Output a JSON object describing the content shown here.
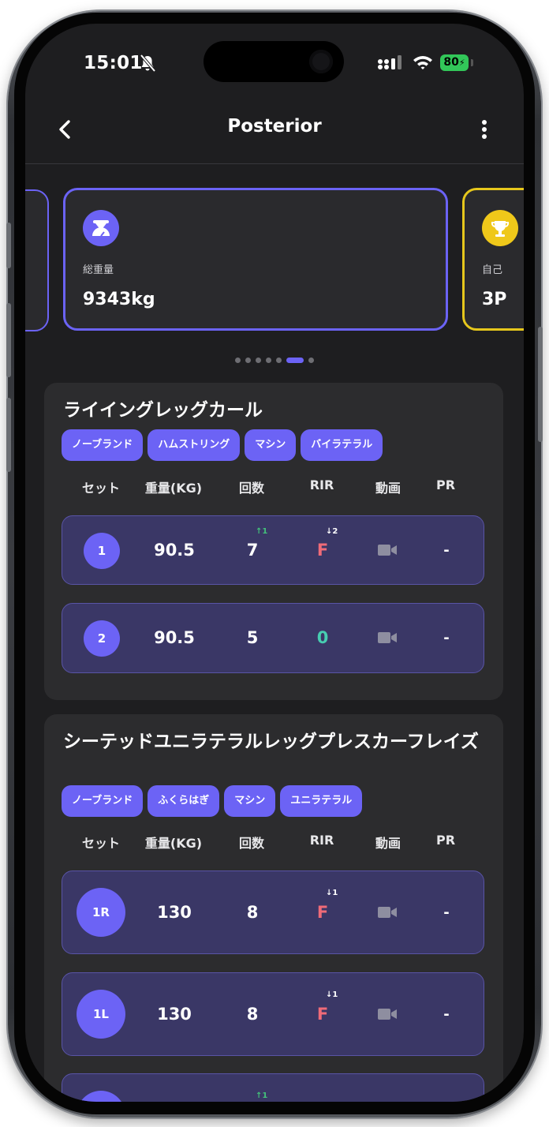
{
  "status_bar": {
    "time": "15:01",
    "battery": "80"
  },
  "header": {
    "title": "Posterior"
  },
  "summary_cards": [
    {
      "label": "総重量",
      "value": "9343kg",
      "icon": "weight-scale-icon",
      "accent": "#6c63f5"
    },
    {
      "label": "自己",
      "value": "3P",
      "icon": "trophy-icon",
      "accent": "#efc81a"
    }
  ],
  "carousel": {
    "dot_count": 7,
    "active_index": 5
  },
  "column_headers": [
    "セット",
    "重量(KG)",
    "回数",
    "RIR",
    "動画",
    "PR"
  ],
  "exercises": [
    {
      "name": "ライイングレッグカール",
      "tags": [
        "ノーブランド",
        "ハムストリング",
        "マシン",
        "バイラテラル"
      ],
      "sets": [
        {
          "set": "1",
          "weight": "90.5",
          "reps": "7",
          "reps_delta": "↑1",
          "rir": "F",
          "rir_delta": "↓2",
          "pr": "-"
        },
        {
          "set": "2",
          "weight": "90.5",
          "reps": "5",
          "reps_delta": "",
          "rir": "0",
          "rir_delta": "",
          "pr": "-"
        }
      ]
    },
    {
      "name": "シーテッドユニラテラルレッグプレスカーフレイズ",
      "tags": [
        "ノーブランド",
        "ふくらはぎ",
        "マシン",
        "ユニラテラル"
      ],
      "sets": [
        {
          "set": "1R",
          "weight": "130",
          "reps": "8",
          "reps_delta": "",
          "rir": "F",
          "rir_delta": "↓1",
          "pr": "-"
        },
        {
          "set": "1L",
          "weight": "130",
          "reps": "8",
          "reps_delta": "",
          "rir": "F",
          "rir_delta": "↓1",
          "pr": "-"
        },
        {
          "set": "",
          "weight": "",
          "reps": "",
          "reps_delta": "↑1",
          "rir": "",
          "rir_delta": "",
          "pr": ""
        }
      ]
    }
  ],
  "colors": {
    "accent": "#6c63f5",
    "fail": "#ef6b78",
    "zero": "#47cdb1",
    "up": "#43c07a",
    "gold": "#efc81a"
  }
}
